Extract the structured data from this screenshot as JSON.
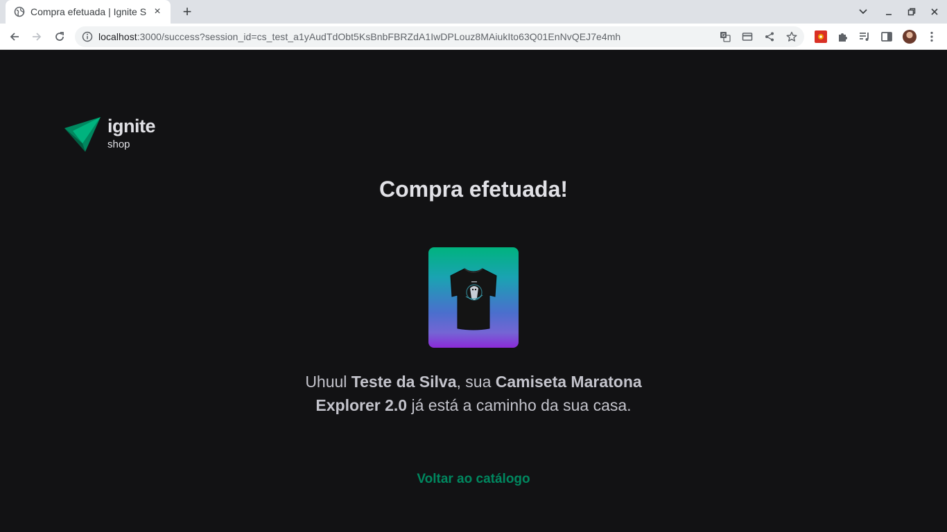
{
  "browser": {
    "tab": {
      "title": "Compra efetuada | Ignite Shop",
      "close_label": "×"
    },
    "new_tab_label": "+",
    "url": {
      "host": "localhost",
      "rest": ":3000/success?session_id=cs_test_a1yAudTdObt5KsBnbFBRZdA1IwDPLouz8MAiukIto63Q01EnNvQEJ7e4mh"
    }
  },
  "page": {
    "logo": {
      "name": "ignite",
      "sub": "shop"
    },
    "title": "Compra efetuada!",
    "message": {
      "greeting": "Uhuul ",
      "customer_name": "Teste da Silva",
      "middle": ", sua ",
      "product_name": "Camiseta Maratona Explorer 2.0",
      "ending": " já está a caminho da sua casa."
    },
    "back_link": "Voltar ao catálogo"
  },
  "colors": {
    "background": "#121214",
    "text": "#e1e1e6",
    "accent": "#00875f",
    "brand_green": "#00b37e",
    "brand_purple": "#8b2ad8"
  },
  "icons": [
    "globe-icon",
    "close-icon",
    "plus-icon",
    "chevron-down-icon",
    "minimize-icon",
    "restore-icon",
    "back-arrow-icon",
    "forward-arrow-icon",
    "reload-icon",
    "info-icon",
    "translate-icon",
    "card-icon",
    "share-icon",
    "star-icon",
    "extension-puzzle-icon",
    "media-icon",
    "side-panel-icon",
    "kebab-menu-icon"
  ]
}
